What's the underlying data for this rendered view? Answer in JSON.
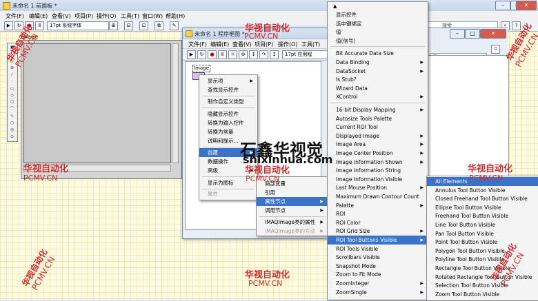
{
  "front_panel": {
    "title": "未命名 1 前面板 *",
    "menu": [
      "文件(F)",
      "编辑(E)",
      "查看(V)",
      "项目(P)",
      "操作(O)",
      "工具(T)",
      "窗口(W)",
      "帮助(H)"
    ],
    "font_label": "17pt 系统字体",
    "search_placeholder": "搜索",
    "image_label": "Image"
  },
  "block_diagram": {
    "title": "未命名 1 程序框图 *",
    "menu": [
      "文件(F)",
      "编辑(E)",
      "查看(V)",
      "项目(P)",
      "操作(O)",
      "工具(T)"
    ],
    "font_label": "17pt 应用程",
    "node_label": "Image",
    "search_placeholder": "索"
  },
  "menu1": {
    "items": [
      {
        "label": "显示项",
        "sub": true
      },
      {
        "label": "查找显示控件"
      },
      {
        "label": "制作自定义类型"
      },
      {
        "label": "隐藏显示控件"
      },
      {
        "label": "转换为输入控件"
      },
      {
        "label": "转换为常量"
      },
      {
        "label": "说明和提示..."
      },
      {
        "label": "创建",
        "sub": true,
        "highlight": true
      },
      {
        "label": "数据操作",
        "sub": true
      },
      {
        "label": "高级",
        "sub": true
      },
      {
        "label": "显示为图标"
      },
      {
        "label": "属性",
        "disabled": true
      }
    ]
  },
  "menu2": {
    "items": [
      {
        "label": "局部变量"
      },
      {
        "label": "引用"
      },
      {
        "label": "属性节点",
        "sub": true,
        "highlight": true
      },
      {
        "label": "调用节点",
        "sub": true
      },
      {
        "label": "IMAQImage类的属性",
        "sub": true
      },
      {
        "label": "IMAQImage类的方法",
        "sub": true,
        "disabled": true
      }
    ]
  },
  "menu3": {
    "items": [
      {
        "label": "显示控件"
      },
      {
        "label": "选中键绑定"
      },
      {
        "label": "值"
      },
      {
        "label": "值(信号)"
      },
      {
        "label": "Bit Accurate Data Size"
      },
      {
        "label": "Data Binding",
        "sub": true
      },
      {
        "label": "DataSocket",
        "sub": true
      },
      {
        "label": "Is Stub?"
      },
      {
        "label": "Wizard Data"
      },
      {
        "label": "XControl",
        "sub": true
      },
      {
        "label": "16-bit Display Mapping",
        "sub": true
      },
      {
        "label": "Autosize Tools Palette"
      },
      {
        "label": "Current ROI Tool"
      },
      {
        "label": "Displayed Image",
        "sub": true
      },
      {
        "label": "Image Area",
        "sub": true
      },
      {
        "label": "Image Center Position",
        "sub": true
      },
      {
        "label": "Image Information Shown",
        "sub": true
      },
      {
        "label": "Image Information String"
      },
      {
        "label": "Image Information Visible"
      },
      {
        "label": "Last Mouse Position",
        "sub": true
      },
      {
        "label": "Maximum Drawn Contour Count"
      },
      {
        "label": "Palette",
        "sub": true
      },
      {
        "label": "ROI"
      },
      {
        "label": "ROI Color"
      },
      {
        "label": "ROI Grid Size",
        "sub": true
      },
      {
        "label": "ROI Tool Buttons Visible",
        "sub": true,
        "highlight": true
      },
      {
        "label": "ROI Tools Visible"
      },
      {
        "label": "Scrollbars Visible"
      },
      {
        "label": "Snapshot Mode"
      },
      {
        "label": "Zoom to Fit Mode"
      },
      {
        "label": "ZoomInteger",
        "sub": true
      },
      {
        "label": "ZoomSingle",
        "sub": true
      }
    ]
  },
  "menu4": {
    "items": [
      {
        "label": "All Elements",
        "highlight": true
      },
      {
        "label": "Annulus Tool Button Visible"
      },
      {
        "label": "Closed Freehand Tool Button Visible"
      },
      {
        "label": "Ellipse Tool Button Visible"
      },
      {
        "label": "Freehand  Tool Button Visible"
      },
      {
        "label": "Line Tool Button Visible"
      },
      {
        "label": "Pan Tool Button Visible"
      },
      {
        "label": "Point Tool Button Visible"
      },
      {
        "label": "Polygon Tool Button Visible"
      },
      {
        "label": "Polyline Tool Button Visible"
      },
      {
        "label": "Rectangle Tool Button Visible"
      },
      {
        "label": "Rotated Rectangle Tool Button Visible"
      },
      {
        "label": "Selection Tool Button Visible"
      },
      {
        "label": "Zoom Tool Button Visible"
      }
    ]
  },
  "watermarks": {
    "cn": "华视自动化",
    "en": "PCMV.CN",
    "site": "shixinhua.com",
    "brand": "石鑫华视觉"
  },
  "icons": [
    "run-arrow-icon",
    "abort-icon",
    "pause-icon",
    "align-icon",
    "search-icon",
    "help-icon"
  ]
}
